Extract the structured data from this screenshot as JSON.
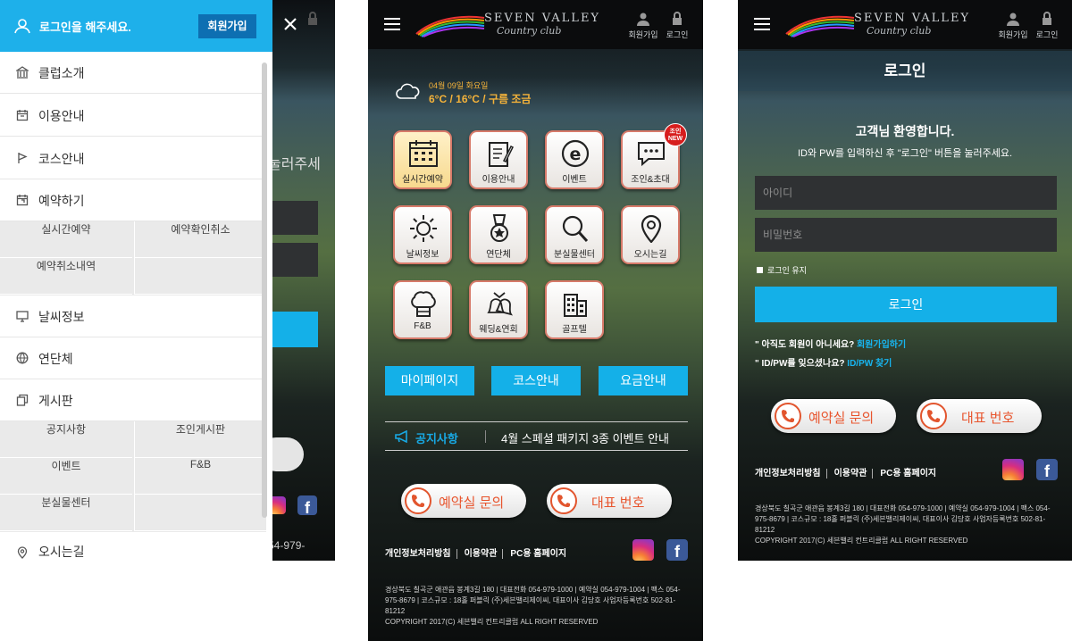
{
  "colors": {
    "accent": "#14b0e8",
    "menu_header": "#1eb0ea",
    "join_button": "#0d6fb2",
    "call_text": "#e8552e",
    "weather_text": "#f4b23a",
    "new_badge": "#d71d1d"
  },
  "menu": {
    "login_prompt": "로그인을 해주세요.",
    "join_label": "회원가입",
    "items": [
      {
        "label": "클럽소개",
        "icon": "building-icon"
      },
      {
        "label": "이용안내",
        "icon": "calendar-icon"
      },
      {
        "label": "코스안내",
        "icon": "flag-icon"
      },
      {
        "label": "예약하기",
        "icon": "calendar-check-icon"
      },
      {
        "label": "날씨정보",
        "icon": "monitor-icon"
      },
      {
        "label": "연단체",
        "icon": "globe-icon"
      },
      {
        "label": "게시판",
        "icon": "copy-icon"
      },
      {
        "label": "오시는길",
        "icon": "pin-icon"
      }
    ],
    "reservation_sub": [
      "실시간예약",
      "예약확인취소",
      "예약취소내역"
    ],
    "board_sub": [
      "공지사항",
      "조인게시판",
      "이벤트",
      "F&B",
      "분실물센터"
    ]
  },
  "behind": {
    "text": "눌러주세",
    "phone": "54-979-"
  },
  "header": {
    "logo_line1": "SEVEN VALLEY",
    "logo_line2": "Country club",
    "join_label": "회원가입",
    "login_label": "로그인"
  },
  "weather": {
    "date": "04월 09일 화요일",
    "temp": "6°C / 16°C / 구름 조금",
    "icon": "cloud-icon"
  },
  "tiles": [
    {
      "label": "실시간예약",
      "icon": "calendar-icon"
    },
    {
      "label": "이용안내",
      "icon": "document-icon"
    },
    {
      "label": "이벤트",
      "icon": "event-icon"
    },
    {
      "label": "조인&초대",
      "icon": "chat-icon",
      "badge": "조인 NEW"
    },
    {
      "label": "날씨정보",
      "icon": "sun-icon"
    },
    {
      "label": "연단체",
      "icon": "medal-icon"
    },
    {
      "label": "분실물센터",
      "icon": "search-icon"
    },
    {
      "label": "오시는길",
      "icon": "pin-icon"
    },
    {
      "label": "F&B",
      "icon": "chef-hat-icon"
    },
    {
      "label": "웨딩&연회",
      "icon": "bells-icon"
    },
    {
      "label": "골프텔",
      "icon": "hotel-icon"
    }
  ],
  "quick": {
    "mypage": "마이페이지",
    "course": "코스안내",
    "fee": "요금안내"
  },
  "notice": {
    "heading": "공지사항",
    "message": "4월 스페셜 패키지 3종 이벤트 안내"
  },
  "calls": {
    "reservation": "예약실 문의",
    "main": "대표 번호"
  },
  "footer": {
    "privacy": "개인정보처리방침",
    "terms": "이용약관",
    "pc": "PC용 홈페이지",
    "addr1": "경상북도 칠곡군 애관읍 봉계3길 180 | 대표전화 054-979-1000 | 예약실 054-979-1004 | 팩스 054-",
    "addr2": "975-8679 | 코스규모 : 18홀 퍼블릭 (주)세븐밸리제이씨, 대표이사 김당호 사업자등록번호 502-81-",
    "addr3": "81212",
    "copyright": "COPYRIGHT 2017(C) 세븐밸리 컨트리클럽 ALL RIGHT RESERVED"
  },
  "login": {
    "title": "로그인",
    "welcome": "고객님 환영합니다.",
    "guide": "ID와 PW를 입력하신 후 \"로그인\" 버튼을 눌러주세요.",
    "id_placeholder": "아이디",
    "pw_placeholder": "비밀번호",
    "keep": "로그인 유지",
    "button": "로그인",
    "no_member": "아직도 회원이 아니세요?",
    "signup_link": "회원가입하기",
    "forgot": "ID/PW를 잊으셨나요?",
    "find_link": "ID/PW 찾기"
  },
  "p3footer": {
    "addr1": "경상북도 칠곡군 애관읍 봉계3길 180 | 대표전화 054-979-1000 | 예약실 054-979-1004 | 팩스 054-",
    "addr2": "975-8679 | 코스규모 : 18홀 퍼블릭 (주)세븐밸리제이씨, 대표이사 김당호 사업자등록번호 502-81-",
    "addr3": "81212"
  }
}
